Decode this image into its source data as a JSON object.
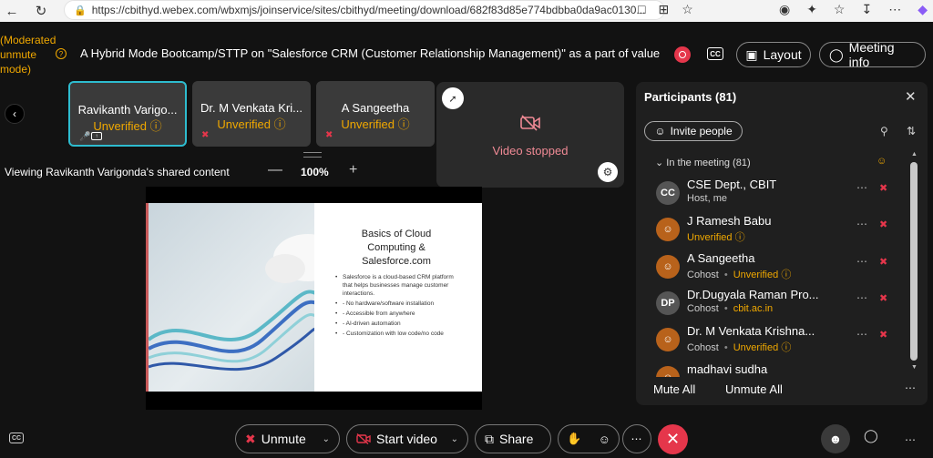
{
  "browser": {
    "url": "https://cbithyd.webex.com/wbxmjs/joinservice/sites/cbithyd/meeting/download/682f83d85e774bdbba0da9ac0130..."
  },
  "topbar": {
    "moderated_line1": "(Moderated",
    "moderated_line2": "unmute",
    "moderated_line3": "mode)",
    "meeting_title": "A Hybrid Mode Bootcamp/STTP on \"Salesforce CRM (Customer Relationship Management)\" as a part of value added cou...",
    "cc_label": "CC",
    "layout_label": "Layout",
    "meeting_info_label": "Meeting info"
  },
  "tiles": [
    {
      "name": "Ravikanth Varigo...",
      "status": "Unverified"
    },
    {
      "name": "Dr. M Venkata Kri...",
      "status": "Unverified"
    },
    {
      "name": "A Sangeetha",
      "status": "Unverified"
    }
  ],
  "stage": {
    "viewing_text": "Viewing Ravikanth Varigonda's shared content",
    "zoom": "100%"
  },
  "selfview": {
    "status_text": "Video stopped"
  },
  "slide": {
    "title_line1": "Basics of Cloud",
    "title_line2": "Computing &",
    "title_line3": "Salesforce.com",
    "bullets": [
      "Salesforce is a cloud-based CRM platform that helps businesses manage customer interactions.",
      "- No hardware/software installation",
      "- Accessible from anywhere",
      "- AI-driven automation",
      "- Customization with low code/no code"
    ]
  },
  "participants_panel": {
    "title": "Participants (81)",
    "invite_label": "Invite people",
    "in_meeting_label": "In the meeting (81)",
    "people": [
      {
        "initials": "CC",
        "name": "CSE Dept., CBIT",
        "role": "Host, me",
        "extra": ""
      },
      {
        "initials": "",
        "name": "J Ramesh Babu",
        "role": "",
        "extra": "Unverified"
      },
      {
        "initials": "",
        "name": "A Sangeetha",
        "role": "Cohost",
        "extra": "Unverified"
      },
      {
        "initials": "DP",
        "name": "Dr.Dugyala Raman Pro...",
        "role": "Cohost",
        "extra": "cbit.ac.in"
      },
      {
        "initials": "",
        "name": "Dr. M Venkata Krishna...",
        "role": "Cohost",
        "extra": "Unverified"
      },
      {
        "initials": "",
        "name": "madhavi sudha",
        "role": "",
        "extra": ""
      }
    ],
    "mute_all_label": "Mute All",
    "unmute_all_label": "Unmute All"
  },
  "controls": {
    "unmute_label": "Unmute",
    "start_video_label": "Start video",
    "share_label": "Share",
    "cc_label": "CC"
  },
  "colors": {
    "accent_unverified": "#f0a800",
    "danger": "#e5364b",
    "active_tile_border": "#2ebccf"
  }
}
